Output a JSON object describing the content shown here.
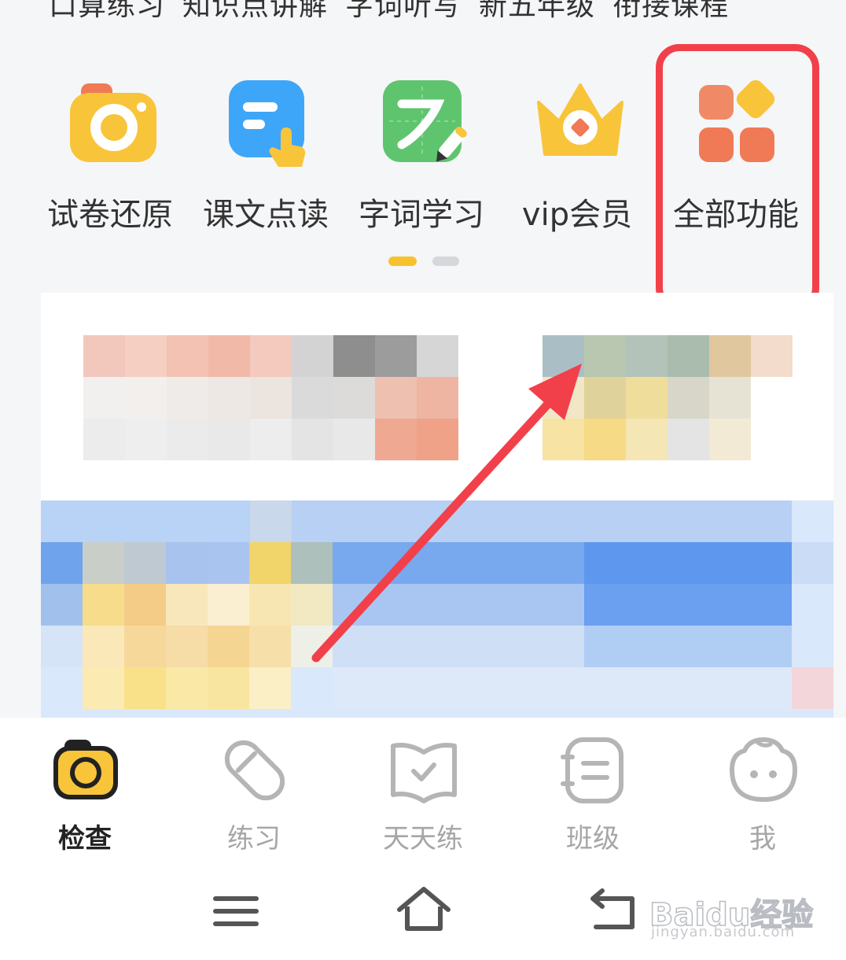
{
  "top_links": [
    "口算练习",
    "知识点讲解",
    "字词听写",
    "新五年级",
    "衔接课程"
  ],
  "features": [
    {
      "label": "试卷还原",
      "icon": "camera-icon"
    },
    {
      "label": "课文点读",
      "icon": "reading-pointer-icon"
    },
    {
      "label": "字词学习",
      "icon": "character-pen-icon"
    },
    {
      "label": "vip会员",
      "icon": "crown-icon"
    },
    {
      "label": "全部功能",
      "icon": "grid-apps-icon"
    }
  ],
  "pagination": {
    "total": 2,
    "active": 1
  },
  "annotation": {
    "color": "#f2404a",
    "highlighted": "全部功能"
  },
  "tabs": [
    {
      "label": "检查",
      "icon": "camera-icon",
      "active": true
    },
    {
      "label": "练习",
      "icon": "eraser-icon",
      "active": false
    },
    {
      "label": "天天练",
      "icon": "book-check-icon",
      "active": false
    },
    {
      "label": "班级",
      "icon": "notebook-icon",
      "active": false
    },
    {
      "label": "我",
      "icon": "baby-face-icon",
      "active": false
    }
  ],
  "system_nav": [
    "menu-icon",
    "home-icon",
    "back-icon"
  ],
  "watermark": {
    "brand": "Bai",
    "brand2": "du",
    "suffix": "经验",
    "url": "jingyan.baidu.com"
  },
  "colors": {
    "accent": "#f6c32d",
    "annotation": "#f2404a",
    "blue": "#3ea6f8",
    "green": "#5fc46e",
    "orange": "#f07a55"
  }
}
